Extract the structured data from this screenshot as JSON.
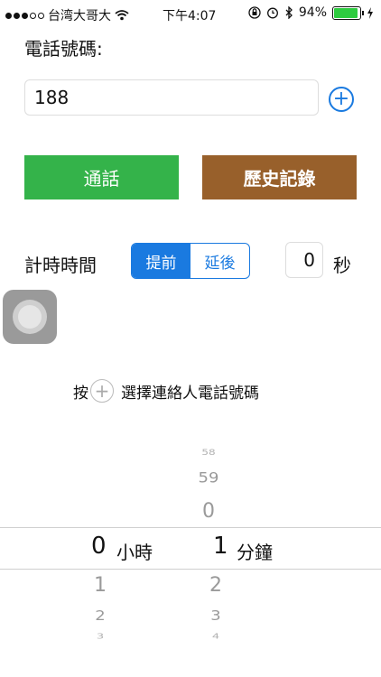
{
  "status_bar": {
    "carrier": "台湾大哥大",
    "time": "下午4:07",
    "battery": "94%",
    "battery_level": 0.94,
    "signal_icon": "signal-dots",
    "wifi_icon": "wifi-icon",
    "bluetooth_icon": "bluetooth-icon",
    "lock_icon": "orientation-lock-icon",
    "alarm_icon": "alarm-icon",
    "charging_icon": "charging-bolt-icon"
  },
  "form": {
    "phone_label": "電話號碼:",
    "phone_value": "188",
    "add_contact_symbol": "+"
  },
  "buttons": {
    "call": "通話",
    "history": "歷史記錄"
  },
  "timer": {
    "label": "計時時間",
    "segments": [
      "提前",
      "延後"
    ],
    "selected_segment": "提前",
    "seconds_value": "0",
    "seconds_unit": "秒"
  },
  "hint": {
    "prefix": "按",
    "plus_symbol": "+",
    "text": "選擇連絡人電話號碼"
  },
  "picker": {
    "hours": {
      "selected": "0",
      "unit": "小時",
      "below": [
        "1",
        "2",
        "3"
      ]
    },
    "minutes": {
      "above": [
        "58",
        "59",
        "0"
      ],
      "selected": "1",
      "unit": "分鐘",
      "below": [
        "2",
        "3",
        "4"
      ]
    }
  },
  "colors": {
    "accent": "#1a7ae0",
    "call_button": "#34b34a",
    "history_button": "#98602b"
  }
}
